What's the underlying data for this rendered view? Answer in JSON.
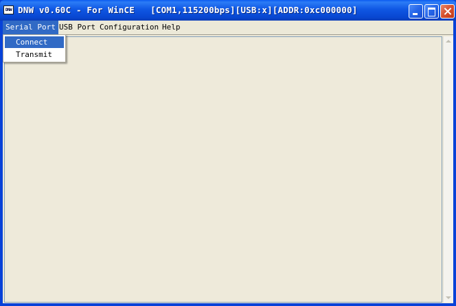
{
  "window": {
    "icon_label": "DNW",
    "title": "DNW v0.60C - For WinCE   [COM1,115200bps][USB:x][ADDR:0xc000000]"
  },
  "menubar": {
    "items": [
      {
        "label": "Serial Port"
      },
      {
        "label": "USB Port"
      },
      {
        "label": "Configuration"
      },
      {
        "label": "Help"
      }
    ]
  },
  "dropdown": {
    "parent": "Serial Port",
    "items": [
      {
        "label": "Connect",
        "highlighted": true
      },
      {
        "label": "Transmit",
        "highlighted": false
      }
    ]
  },
  "output": {
    "text": ""
  },
  "colors": {
    "titlebar": "#0842D8",
    "menu_highlight": "#316AC5",
    "background": "#ECE9D8",
    "close_button": "#D6502E"
  }
}
